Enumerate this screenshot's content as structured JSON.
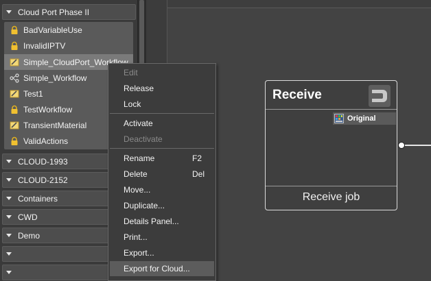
{
  "tree": {
    "expanded_folder": "Cloud Port Phase II",
    "items": [
      {
        "label": "BadVariableUse",
        "icon": "lock-icon"
      },
      {
        "label": "InvalidIPTV",
        "icon": "lock-icon"
      },
      {
        "label": "Simple_CloudPort_Workflow",
        "icon": "pencil-icon"
      },
      {
        "label": "Simple_Workflow",
        "icon": "workflow-icon"
      },
      {
        "label": "Test1",
        "icon": "pencil-icon"
      },
      {
        "label": "TestWorkflow",
        "icon": "lock-icon"
      },
      {
        "label": "TransientMaterial",
        "icon": "pencil-icon"
      },
      {
        "label": "ValidActions",
        "icon": "lock-icon"
      }
    ],
    "folders": [
      "CLOUD-1993",
      "CLOUD-2152",
      "Containers",
      "CWD",
      "Demo",
      "",
      ""
    ]
  },
  "context_menu": {
    "items": [
      {
        "label": "Edit",
        "disabled": true
      },
      {
        "label": "Release"
      },
      {
        "label": "Lock"
      },
      {
        "label": "Activate"
      },
      {
        "label": "Deactivate",
        "disabled": true
      },
      {
        "label": "Rename",
        "shortcut": "F2"
      },
      {
        "label": "Delete",
        "shortcut": "Del"
      },
      {
        "label": "Move..."
      },
      {
        "label": "Duplicate..."
      },
      {
        "label": "Details Panel..."
      },
      {
        "label": "Print..."
      },
      {
        "label": "Export..."
      },
      {
        "label": "Export for Cloud...",
        "highlighted": true
      }
    ]
  },
  "node": {
    "title": "Receive",
    "port_label": "Original",
    "footer": "Receive job",
    "icon": "receive-icon"
  }
}
